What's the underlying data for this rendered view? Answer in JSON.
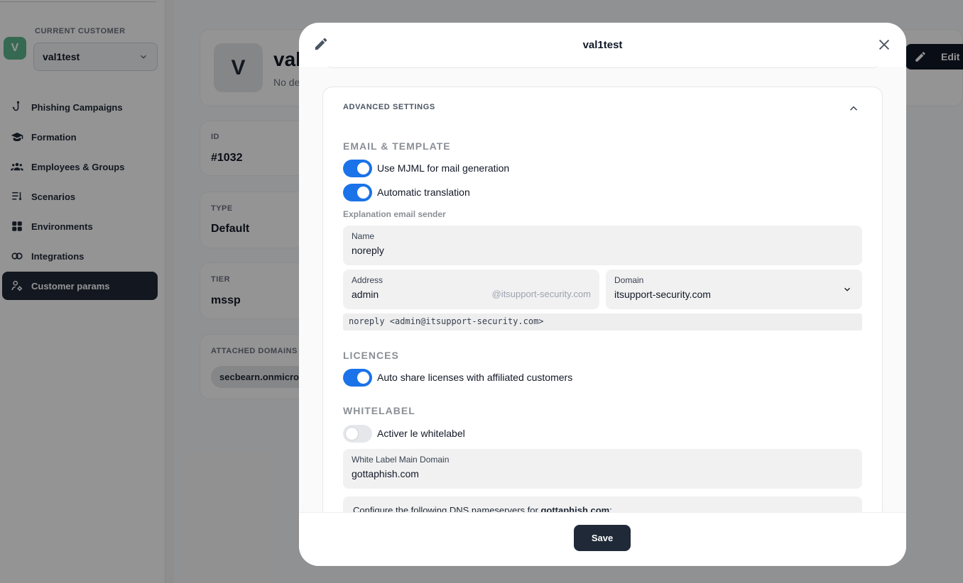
{
  "sidebar": {
    "customer_label": "CURRENT CUSTOMER",
    "customer_initial": "V",
    "customer_name": "val1test",
    "items": [
      {
        "label": "Phishing Campaigns",
        "icon": "hook-icon"
      },
      {
        "label": "Formation",
        "icon": "graduation-cap-icon"
      },
      {
        "label": "Employees & Groups",
        "icon": "users-icon"
      },
      {
        "label": "Scenarios",
        "icon": "list-icon"
      },
      {
        "label": "Environments",
        "icon": "grid-icon"
      },
      {
        "label": "Integrations",
        "icon": "integrations-icon"
      },
      {
        "label": "Customer params",
        "icon": "user-settings-icon",
        "active": true
      }
    ]
  },
  "background": {
    "avatar_initial": "V",
    "title": "val",
    "subtitle": "No de",
    "id_label": "ID",
    "id_value": "#1032",
    "type_label": "TYPE",
    "type_value": "Default",
    "tier_label": "TIER",
    "tier_value": "mssp",
    "domains_label": "ATTACHED DOMAINS",
    "domain_chip": "secbearn.onmicros",
    "edit_label": "Edit"
  },
  "modal": {
    "title": "val1test",
    "advanced_settings_label": "ADVANCED SETTINGS",
    "email_template": {
      "heading": "EMAIL & TEMPLATE",
      "mjml_label": "Use MJML for mail generation",
      "mjml_on": true,
      "translation_label": "Automatic translation",
      "translation_on": true,
      "explanation_label": "Explanation email sender",
      "name_label": "Name",
      "name_value": "noreply",
      "address_label": "Address",
      "address_value": "admin",
      "address_suffix": "@itsupport-security.com",
      "domain_label": "Domain",
      "domain_value": "itsupport-security.com",
      "preview": "noreply <admin@itsupport-security.com>"
    },
    "licences": {
      "heading": "LICENCES",
      "auto_share_label": "Auto share licenses with affiliated customers",
      "auto_share_on": true
    },
    "whitelabel": {
      "heading": "WHITELABEL",
      "activate_label": "Activer le whitelabel",
      "activate_on": false,
      "main_domain_label": "White Label Main Domain",
      "main_domain_value": "gottaphish.com",
      "dns_text": "Configure the following DNS nameservers for ",
      "dns_domain": "gottaphish.com",
      "dns_suffix": ":"
    },
    "save_label": "Save"
  },
  "colors": {
    "accent": "#1a73e8",
    "dark": "#1f2937",
    "avatar": "#5eb58d"
  }
}
